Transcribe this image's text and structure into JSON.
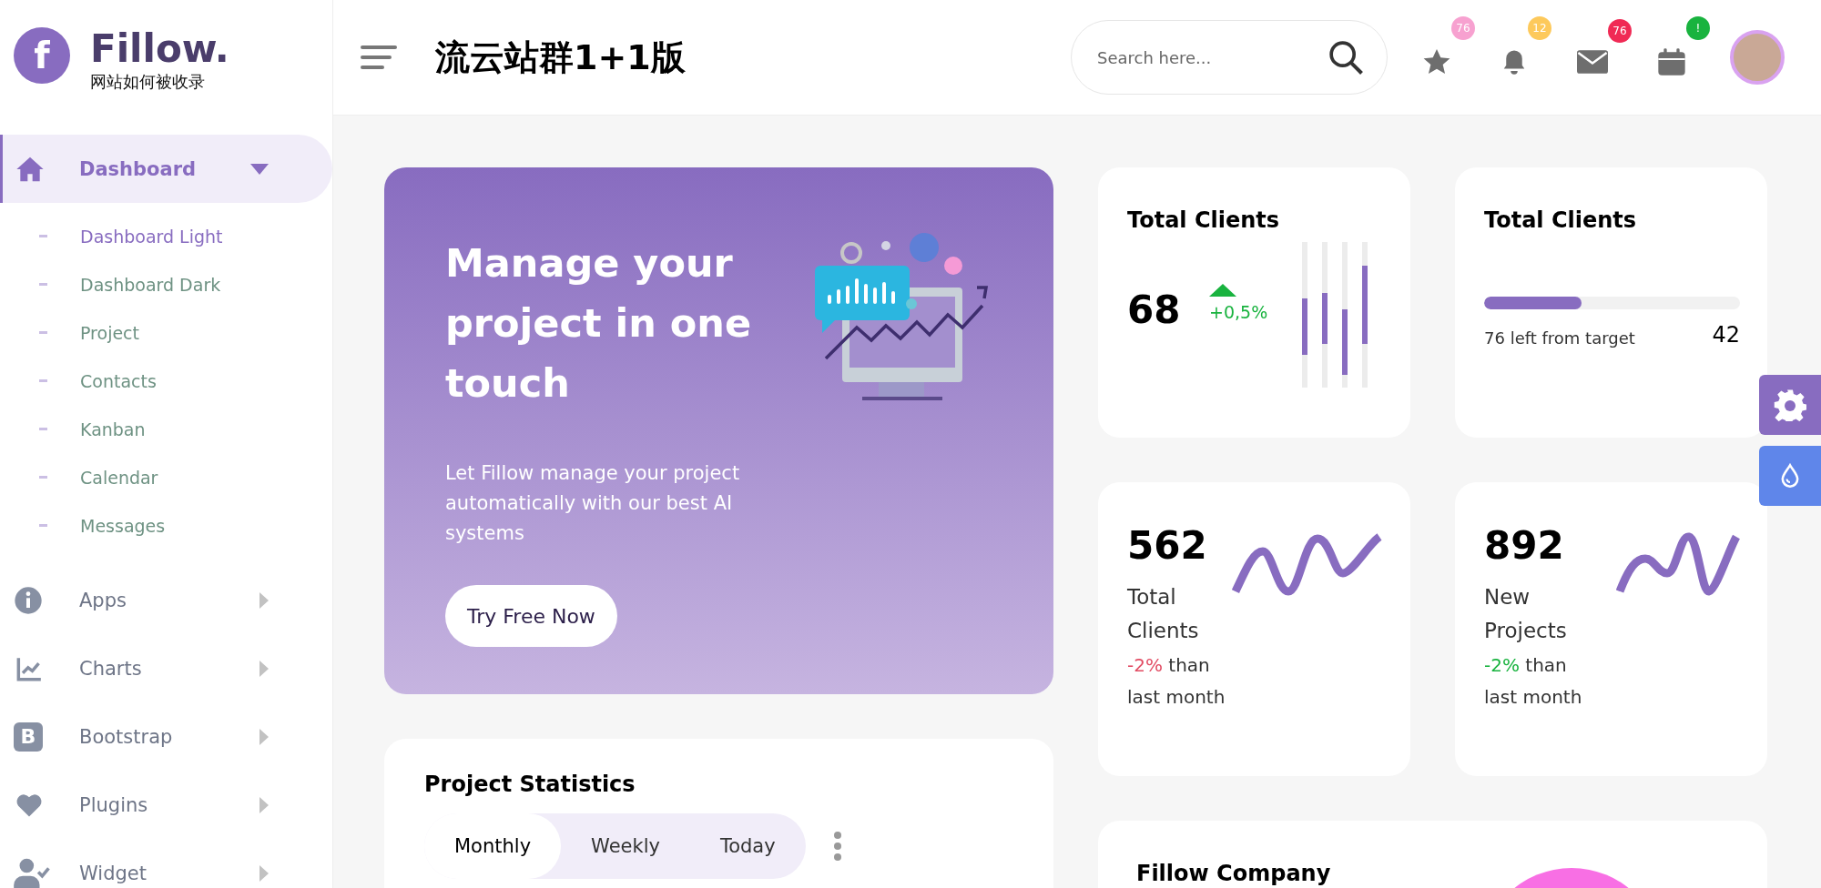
{
  "sidebar": {
    "logo": {
      "letter": "f",
      "name": "Fillow.",
      "tagline": "网站如何被收录"
    },
    "items": [
      {
        "label": "Dashboard",
        "selected": true,
        "expanded": true,
        "children": [
          {
            "label": "Dashboard Light",
            "selected": true
          },
          {
            "label": "Dashboard Dark",
            "selected": false
          },
          {
            "label": "Project",
            "selected": false
          },
          {
            "label": "Contacts",
            "selected": false
          },
          {
            "label": "Kanban",
            "selected": false
          },
          {
            "label": "Calendar",
            "selected": false
          },
          {
            "label": "Messages",
            "selected": false
          }
        ]
      },
      {
        "label": "Apps",
        "selected": false,
        "expanded": false
      },
      {
        "label": "Charts",
        "selected": false,
        "expanded": false
      },
      {
        "label": "Bootstrap",
        "icon_text": "B",
        "selected": false,
        "expanded": false
      },
      {
        "label": "Plugins",
        "selected": false,
        "expanded": false
      },
      {
        "label": "Widget",
        "selected": false,
        "expanded": false
      }
    ]
  },
  "header": {
    "title": "流云站群1+1版",
    "search": {
      "placeholder": "Search here..."
    },
    "notifications": [
      {
        "count": "76",
        "color": "#f7a1d0"
      },
      {
        "count": "12",
        "color": "#fdc95b"
      },
      {
        "count": "76",
        "color": "#f02a55"
      },
      {
        "count": "!",
        "color": "#19b33f"
      }
    ]
  },
  "hero": {
    "title": "Manage your project in one touch",
    "text": "Let Fillow manage your project automatically with our best AI systems",
    "button": "Try Free Now"
  },
  "cards": [
    {
      "kind": "bars",
      "title": "Total Clients",
      "value": "68",
      "change": "+0,5%",
      "color": "#19b33f"
    },
    {
      "kind": "progress",
      "title": "Total Clients",
      "level": 0.38,
      "caption": "76 left from target",
      "value": "42"
    },
    {
      "kind": "wave",
      "value": "562",
      "label": "Total Clients",
      "change": "-2%",
      "suffix": " than last month",
      "color": "#e24c63"
    },
    {
      "kind": "wave2",
      "value": "892",
      "label": "New Projects",
      "change": "-2%",
      "suffix": " than last month",
      "color": "#19b33f"
    }
  ],
  "project_statistics": {
    "title": "Project Statistics",
    "tabs": [
      {
        "label": "Monthly",
        "selected": true
      },
      {
        "label": "Weekly",
        "selected": false
      },
      {
        "label": "Today",
        "selected": false
      }
    ]
  },
  "company": {
    "title": "Fillow Company"
  }
}
